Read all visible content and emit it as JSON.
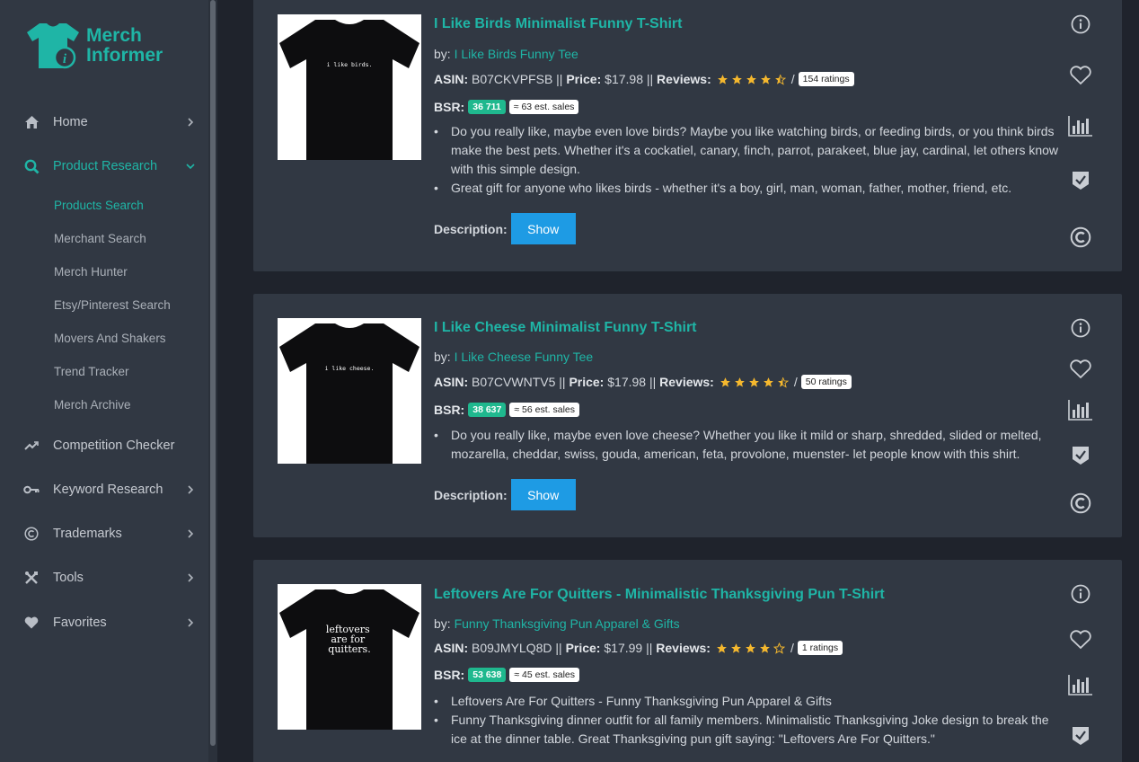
{
  "brand": {
    "line1": "Merch",
    "line2": "Informer",
    "color": "#1fb5a6"
  },
  "sidebar": {
    "items": [
      {
        "label": "Home",
        "icon": "home-icon"
      },
      {
        "label": "Product Research",
        "icon": "search-icon"
      },
      {
        "label": "Competition Checker",
        "icon": "trend-icon"
      },
      {
        "label": "Keyword Research",
        "icon": "key-icon"
      },
      {
        "label": "Trademarks",
        "icon": "copyright-icon"
      },
      {
        "label": "Tools",
        "icon": "tools-icon"
      },
      {
        "label": "Favorites",
        "icon": "heart-icon"
      }
    ],
    "subitems": [
      {
        "label": "Products Search"
      },
      {
        "label": "Merchant Search"
      },
      {
        "label": "Merch Hunter"
      },
      {
        "label": "Etsy/Pinterest Search"
      },
      {
        "label": "Movers And Shakers"
      },
      {
        "label": "Trend Tracker"
      },
      {
        "label": "Merch Archive"
      }
    ]
  },
  "labels": {
    "by": "by:",
    "asin": "ASIN:",
    "price": "Price:",
    "reviews": "Reviews:",
    "bsr": "BSR:",
    "description": "Description:",
    "show": "Show",
    "sep": "||",
    "slash": "/"
  },
  "products": [
    {
      "title": "I Like Birds Minimalist Funny T-Shirt",
      "brand": "I Like Birds Funny Tee",
      "asin": "B07CKVPFSB",
      "price": "$17.98",
      "rating": 4.5,
      "ratings_count": "154 ratings",
      "bsr_rank": "36 711",
      "est_sales": "≈ 63 est. sales",
      "shirt_text": "i like birds.",
      "bullets": [
        "Do you really like, maybe even love birds? Maybe you like watching birds, or feeding birds, or you think birds make the best pets. Whether it's a cockatiel, canary, finch, parrot, parakeet, blue jay, cardinal, let others know with this simple design.",
        "Great gift for anyone who likes birds - whether it's a boy, girl, man, woman, father, mother, friend, etc."
      ]
    },
    {
      "title": "I Like Cheese Minimalist Funny T-Shirt",
      "brand": "I Like Cheese Funny Tee",
      "asin": "B07CVWNTV5",
      "price": "$17.98",
      "rating": 4.5,
      "ratings_count": "50 ratings",
      "bsr_rank": "38 637",
      "est_sales": "≈ 56 est. sales",
      "shirt_text": "i like cheese.",
      "bullets": [
        "Do you really like, maybe even love cheese? Whether you like it mild or sharp, shredded, slided or melted, mozarella, cheddar, swiss, gouda, american, feta, provolone, muenster- let people know with this shirt."
      ]
    },
    {
      "title": "Leftovers Are For Quitters - Minimalistic Thanksgiving Pun T-Shirt",
      "brand": "Funny Thanksgiving Pun Apparel & Gifts",
      "asin": "B09JMYLQ8D",
      "price": "$17.99",
      "rating": 4,
      "ratings_count": "1 ratings",
      "bsr_rank": "53 638",
      "est_sales": "≈ 45 est. sales",
      "shirt_text": "leftovers are for quitters.",
      "bullets": [
        "Leftovers Are For Quitters - Funny Thanksgiving Pun Apparel & Gifts",
        "Funny Thanksgiving dinner outfit for all family members. Minimalistic Thanksgiving Joke design to break the ice at the dinner table. Great Thanksgiving pun gift saying: \"Leftovers Are For Quitters.\""
      ]
    }
  ],
  "colors": {
    "accent": "#1fb5a6",
    "bsr_badge": "#1fb88e",
    "show_button": "#1e9be4",
    "star": "#f5b82e"
  }
}
